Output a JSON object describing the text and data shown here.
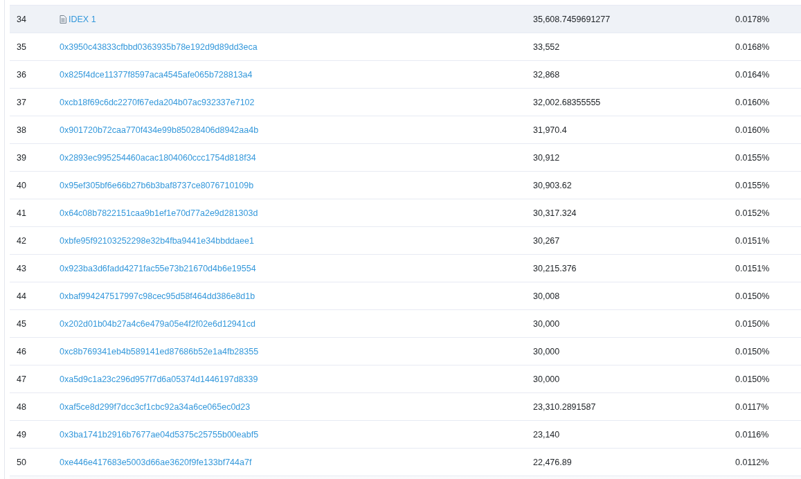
{
  "rows": [
    {
      "rank": "34",
      "kind": "contract",
      "address": "IDEX 1",
      "quantity": "35,608.7459691277",
      "percentage": "0.0178%",
      "selected": true
    },
    {
      "rank": "35",
      "kind": "address",
      "address": "0x3950c43833cfbbd0363935b78e192d9d89dd3eca",
      "quantity": "33,552",
      "percentage": "0.0168%",
      "selected": false
    },
    {
      "rank": "36",
      "kind": "address",
      "address": "0x825f4dce11377f8597aca4545afe065b728813a4",
      "quantity": "32,868",
      "percentage": "0.0164%",
      "selected": false
    },
    {
      "rank": "37",
      "kind": "address",
      "address": "0xcb18f69c6dc2270f67eda204b07ac932337e7102",
      "quantity": "32,002.68355555",
      "percentage": "0.0160%",
      "selected": false
    },
    {
      "rank": "38",
      "kind": "address",
      "address": "0x901720b72caa770f434e99b85028406d8942aa4b",
      "quantity": "31,970.4",
      "percentage": "0.0160%",
      "selected": false
    },
    {
      "rank": "39",
      "kind": "address",
      "address": "0x2893ec995254460acac1804060ccc1754d818f34",
      "quantity": "30,912",
      "percentage": "0.0155%",
      "selected": false
    },
    {
      "rank": "40",
      "kind": "address",
      "address": "0x95ef305bf6e66b27b6b3baf8737ce8076710109b",
      "quantity": "30,903.62",
      "percentage": "0.0155%",
      "selected": false
    },
    {
      "rank": "41",
      "kind": "address",
      "address": "0x64c08b7822151caa9b1ef1e70d77a2e9d281303d",
      "quantity": "30,317.324",
      "percentage": "0.0152%",
      "selected": false
    },
    {
      "rank": "42",
      "kind": "address",
      "address": "0xbfe95f92103252298e32b4fba9441e34bbddaee1",
      "quantity": "30,267",
      "percentage": "0.0151%",
      "selected": false
    },
    {
      "rank": "43",
      "kind": "address",
      "address": "0x923ba3d6fadd4271fac55e73b21670d4b6e19554",
      "quantity": "30,215.376",
      "percentage": "0.0151%",
      "selected": false
    },
    {
      "rank": "44",
      "kind": "address",
      "address": "0xbaf994247517997c98cec95d58f464dd386e8d1b",
      "quantity": "30,008",
      "percentage": "0.0150%",
      "selected": false
    },
    {
      "rank": "45",
      "kind": "address",
      "address": "0x202d01b04b27a4c6e479a05e4f2f02e6d12941cd",
      "quantity": "30,000",
      "percentage": "0.0150%",
      "selected": false
    },
    {
      "rank": "46",
      "kind": "address",
      "address": "0xc8b769341eb4b589141ed87686b52e1a4fb28355",
      "quantity": "30,000",
      "percentage": "0.0150%",
      "selected": false
    },
    {
      "rank": "47",
      "kind": "address",
      "address": "0xa5d9c1a23c296d957f7d6a05374d1446197d8339",
      "quantity": "30,000",
      "percentage": "0.0150%",
      "selected": false
    },
    {
      "rank": "48",
      "kind": "address",
      "address": "0xaf5ce8d299f7dcc3cf1cbc92a34a6ce065ec0d23",
      "quantity": "23,310.2891587",
      "percentage": "0.0117%",
      "selected": false
    },
    {
      "rank": "49",
      "kind": "address",
      "address": "0x3ba1741b2916b7677ae04d5375c25755b00eabf5",
      "quantity": "23,140",
      "percentage": "0.0116%",
      "selected": false
    },
    {
      "rank": "50",
      "kind": "address",
      "address": "0xe446e417683e5003d66ae3620f9fe133bf744a7f",
      "quantity": "22,476.89",
      "percentage": "0.0112%",
      "selected": false
    }
  ]
}
